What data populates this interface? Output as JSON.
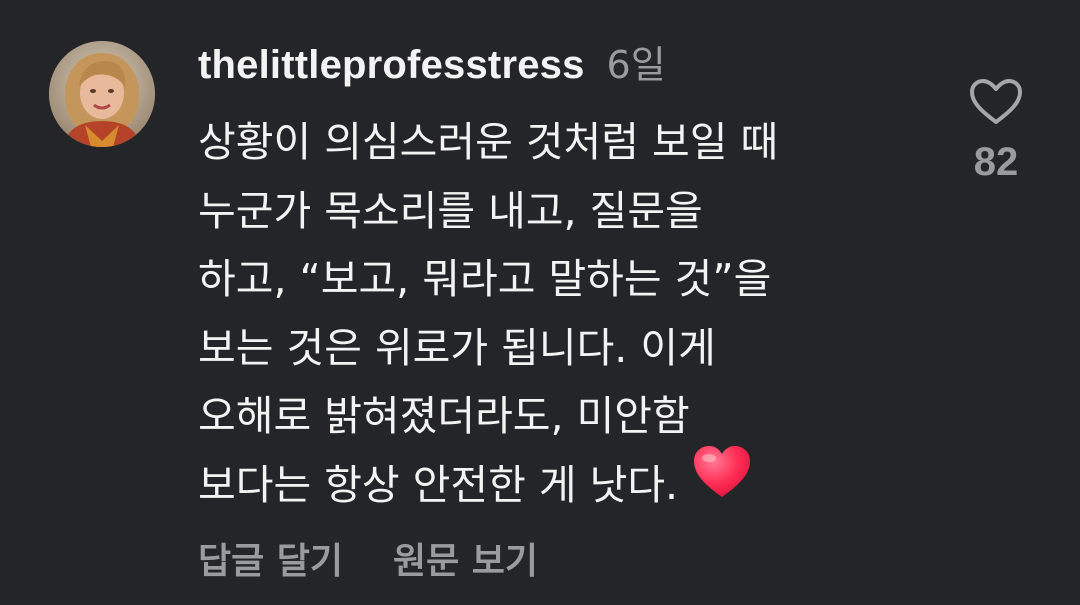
{
  "comment": {
    "username": "thelittleprofesstress",
    "time": "6일",
    "body_lines": [
      "상황이 의심스러운 것처럼 보일 때",
      "누군가 목소리를 내고, 질문을",
      "하고, “보고, 뭐라고 말하는 것”을",
      "보는 것은 위로가 됩니다. 이게",
      "오해로 밝혀졌더라도, 미안함",
      "보다는 항상 안전한 게 낫다."
    ],
    "trailing_emoji": "red-heart-emoji",
    "likes": "82",
    "reply_label": "답글 달기",
    "see_original_label": "원문 보기"
  },
  "icons": {
    "like": "heart-outline-icon"
  },
  "colors": {
    "background": "#242528",
    "primary_text": "#f3f3f3",
    "secondary_text": "#9a9b9f",
    "emoji_heart": "#ff2d55"
  }
}
